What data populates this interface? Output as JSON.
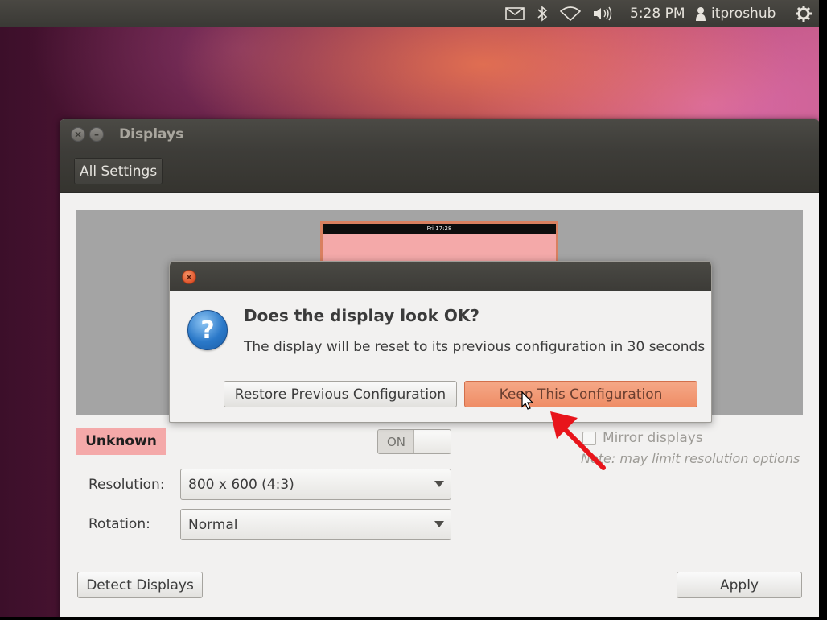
{
  "top_panel": {
    "time": "5:28 PM",
    "user": "itproshub",
    "icons": [
      "mail-icon",
      "bluetooth-icon",
      "wifi-icon",
      "volume-icon",
      "user-icon",
      "gear-icon"
    ]
  },
  "window": {
    "title": "Displays",
    "all_settings_label": "All Settings",
    "monitor_clock": "Fri 17:28",
    "output_name": "Unknown",
    "switch_label": "ON",
    "mirror_label": "Mirror displays",
    "mirror_note": "Note: may limit resolution options",
    "resolution_label": "Resolution:",
    "resolution_value": "800 x 600 (4:3)",
    "rotation_label": "Rotation:",
    "rotation_value": "Normal",
    "detect_label": "Detect Displays",
    "apply_label": "Apply"
  },
  "dialog": {
    "heading": "Does the display look OK?",
    "message": "The display will be reset to its previous configuration in 30 seconds",
    "restore_label": "Restore Previous Configuration",
    "keep_label": "Keep This Configuration"
  },
  "colors": {
    "accent_orange": "#ef8d66",
    "highlight_pink": "#f4a9a9",
    "arrow_red": "#e8141b"
  }
}
